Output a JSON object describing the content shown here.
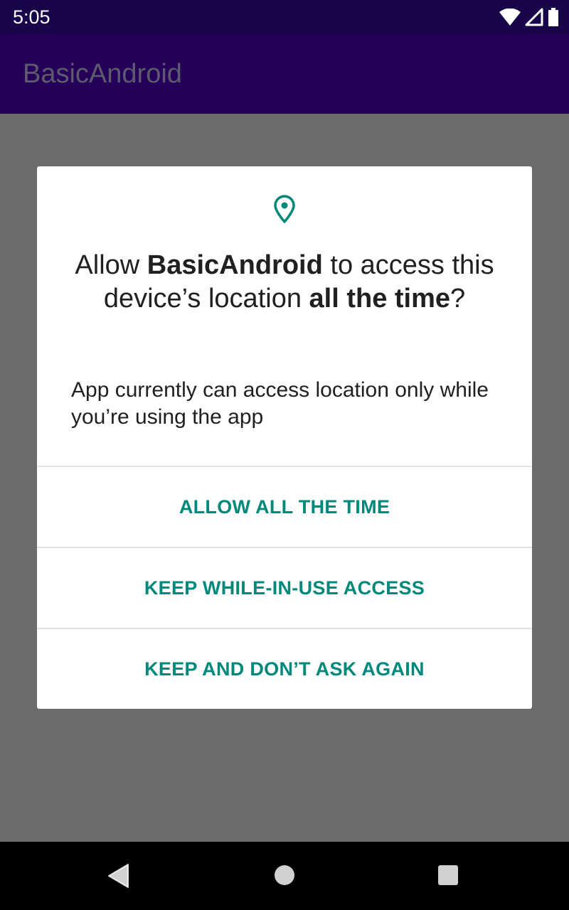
{
  "status_bar": {
    "time": "5:05",
    "icons": [
      "wifi-icon",
      "signal-icon",
      "battery-icon"
    ]
  },
  "app_bar": {
    "title": "BasicAndroid"
  },
  "dialog": {
    "icon": "location-pin-icon",
    "title_parts": {
      "p1": "Allow ",
      "p2": "BasicAndroid",
      "p3": " to access this device’s location ",
      "p4": "all the time",
      "p5": "?"
    },
    "message": "App currently can access location only while you’re using the app",
    "buttons": [
      {
        "label": "ALLOW ALL THE TIME"
      },
      {
        "label": "KEEP WHILE-IN-USE ACCESS"
      },
      {
        "label": "KEEP AND DON’T ASK AGAIN"
      }
    ]
  },
  "nav_bar": {
    "icons": [
      "back-icon",
      "home-icon",
      "recents-icon"
    ]
  },
  "colors": {
    "status_bar": "#180448",
    "app_bar": "#24005a",
    "scrim": "#6b6b6b",
    "accent": "#00897b"
  }
}
